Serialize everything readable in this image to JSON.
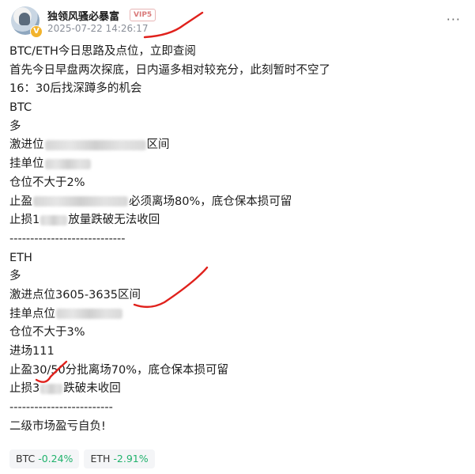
{
  "author": {
    "avatar_badge": "V",
    "name": "独领风骚必暴富",
    "vip_label": "VIP5",
    "timestamp": "2025-07-22 14:26:17"
  },
  "post": {
    "lines": {
      "title": "BTC/ETH今日思路及点位，立即查阅",
      "intro1": "首先今日早盘两次探底，日内逼多相对较充分，此刻暂时不空了",
      "intro2": "16：30后找深蹲多的机会",
      "btc_head": "BTC",
      "btc_dir": "多",
      "btc_aggr_a": "激进位",
      "btc_aggr_b": "区间",
      "btc_limit": "挂单位",
      "btc_pos": "仓位不大于2%",
      "btc_tp_a": "止盈",
      "btc_tp_b": "必须离场80%，底仓保本损可留",
      "btc_sl_a": "止损1",
      "btc_sl_b": "放量跌破无法收回",
      "divider1": "----------------------------",
      "eth_head": "ETH",
      "eth_dir": "多",
      "eth_aggr": "激进点位3605-3635区间",
      "eth_limit": "挂单点位",
      "eth_pos": "仓位不大于3%",
      "eth_entry": "进场111",
      "eth_tp": "止盈30/50分批离场70%，底仓保本损可留",
      "eth_sl_a": "止损3",
      "eth_sl_b": "跌破未收回",
      "divider2": "-------------------------",
      "disclaimer": "二级市场盈亏自负!"
    }
  },
  "tickers": [
    {
      "symbol": "BTC",
      "change": "-0.24%"
    },
    {
      "symbol": "ETH",
      "change": "-2.91%"
    }
  ],
  "colors": {
    "annotation": "#e0211c",
    "change_text": "#20b26c",
    "vip": "#d97a7a"
  },
  "icons": {
    "more": "more-horizontal-icon"
  }
}
